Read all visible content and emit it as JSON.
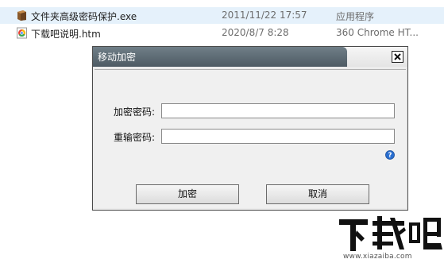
{
  "files": [
    {
      "name": "文件夹高级密码保护.exe",
      "date": "2011/11/22 17:57",
      "type": "应用程序",
      "icon": "exe-file-icon",
      "selected": true
    },
    {
      "name": "下载吧说明.htm",
      "date": "2020/8/7 8:28",
      "type": "360 Chrome HT...",
      "icon": "chrome-html-file-icon",
      "selected": false
    }
  ],
  "dialog": {
    "title": "移动加密",
    "password_label": "加密密码:",
    "confirm_label": "重输密码:",
    "password_value": "",
    "confirm_value": "",
    "ok_label": "加密",
    "cancel_label": "取消"
  },
  "watermark": {
    "logo_text": "下载吧",
    "url": "www.xiazaiba.com"
  },
  "colors": {
    "title_bar": "#5a6870",
    "help_icon": "#2a6fd0",
    "selected_row": "#e5f1fb"
  }
}
